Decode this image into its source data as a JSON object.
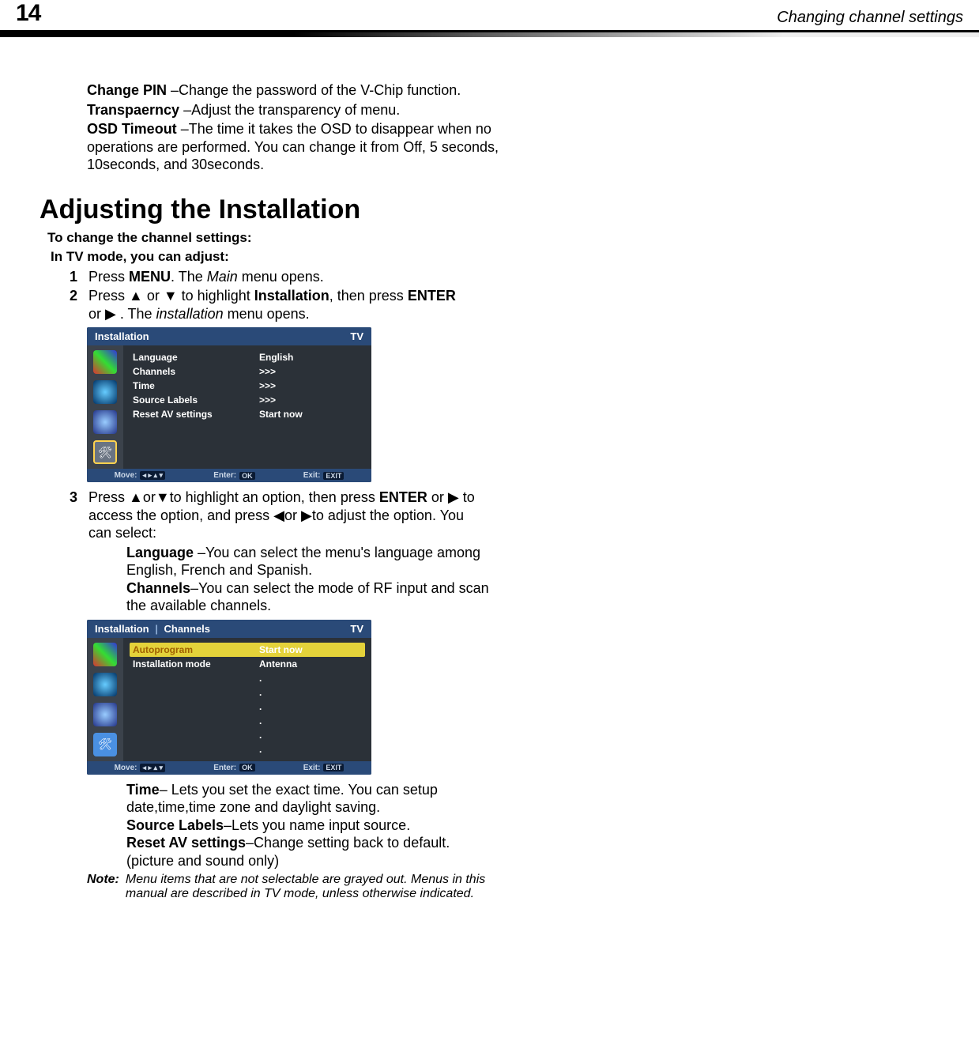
{
  "header": {
    "page_number": "14",
    "title": "Changing channel settings"
  },
  "intro": {
    "change_pin": {
      "label": "Change PIN",
      "desc": "–Change the password of the V-Chip function."
    },
    "transparency": {
      "label": "Transpaerncy",
      "desc": "–Adjust the transparency of menu."
    },
    "osd_timeout": {
      "label": "OSD Timeout ",
      "desc": "–The time it takes the OSD to disappear when no operations are performed. You can change it from Off, 5 seconds, 10seconds, and 30seconds."
    }
  },
  "section_title": "Adjusting the Installation",
  "sub1": "To change the channel settings:",
  "sub2": "In TV mode, you can adjust:",
  "steps": {
    "s1": {
      "num": "1",
      "pre": "Press ",
      "menu": "MENU",
      "post": ". The ",
      "main": "Main",
      "tail": " menu opens."
    },
    "s2": {
      "num": "2",
      "t1": "Press ",
      "arrows1": "▲ or ▼",
      "t2": " to highlight ",
      "inst": "Installation",
      "t3": ", then press ",
      "enter": "ENTER",
      "t4": " or ▶ . The ",
      "inst2": "installation",
      "t5": " menu opens."
    },
    "s3": {
      "num": "3",
      "t1": "Press ",
      "arrows1": "▲or▼",
      "t2": "to highlight an option, then press ",
      "enter": "ENTER",
      "t3": " or ▶ to access the option, and press ◀or ▶to adjust the option. You can select:"
    }
  },
  "osd1": {
    "title": "Installation",
    "mode": "TV",
    "rows": [
      {
        "label": "Language",
        "value": "English"
      },
      {
        "label": "Channels",
        "value": ">>>"
      },
      {
        "label": "Time",
        "value": ">>>"
      },
      {
        "label": "Source Labels",
        "value": ">>>"
      },
      {
        "label": "Reset AV settings",
        "value": "Start now"
      }
    ],
    "footer": {
      "move": "Move:",
      "arrows": "◂ ▸ ▴ ▾",
      "enter": "Enter:",
      "ok": "OK",
      "exit": "Exit:",
      "exitbtn": "EXIT"
    }
  },
  "descs": {
    "language": {
      "label": "Language",
      "desc": " –You can select the menu's language among English, French and Spanish."
    },
    "channels": {
      "label": "Channels",
      "desc": "–You can select the mode of RF input and scan the available channels."
    }
  },
  "osd2": {
    "title_a": "Installation",
    "title_b": "Channels",
    "mode": "TV",
    "rows": [
      {
        "label": "Autoprogram",
        "value": "Start now",
        "hl": true
      },
      {
        "label": "Installation mode",
        "value": "Antenna"
      }
    ],
    "footer": {
      "move": "Move:",
      "arrows": "◂ ▸ ▴ ▾",
      "enter": "Enter:",
      "ok": "OK",
      "exit": "Exit:",
      "exitbtn": "EXIT"
    }
  },
  "descs2": {
    "time": {
      "label": "Time",
      "desc": "– Lets you set the exact time. You can setup date,time,time zone and daylight saving."
    },
    "source": {
      "label": "Source Labels",
      "desc": "–Lets you name input source."
    },
    "reset": {
      "label": "Reset AV settings",
      "desc": "–Change setting back to default. (picture and sound only)"
    }
  },
  "note": {
    "label": "Note:",
    "text": "Menu items that are not selectable are grayed out. Menus in this manual are described in TV mode, unless otherwise indicated."
  }
}
